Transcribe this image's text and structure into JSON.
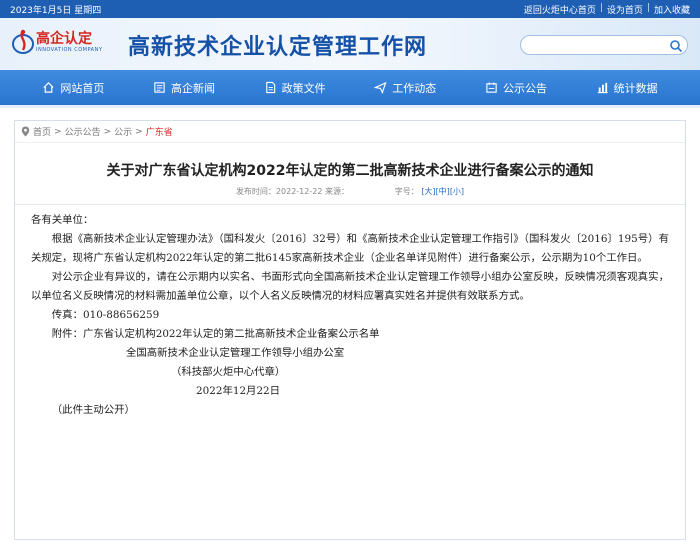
{
  "topbar": {
    "date": "2023年1月5日 星期四",
    "links": [
      "返回火炬中心首页",
      "设为首页",
      "加入收藏"
    ]
  },
  "header": {
    "logo_cn": "高企认定",
    "logo_en": "INNOVATION COMPANY",
    "site_title": "高新技术企业认定管理工作网",
    "search_placeholder": ""
  },
  "nav": {
    "items": [
      {
        "label": "网站首页",
        "icon": "home-icon"
      },
      {
        "label": "高企新闻",
        "icon": "news-icon"
      },
      {
        "label": "政策文件",
        "icon": "document-icon"
      },
      {
        "label": "工作动态",
        "icon": "paper-plane-icon"
      },
      {
        "label": "公示公告",
        "icon": "notice-icon"
      },
      {
        "label": "统计数据",
        "icon": "chart-icon"
      }
    ]
  },
  "breadcrumb": {
    "items": [
      "首页",
      "公示公告",
      "公示"
    ],
    "separator": ">",
    "current": "广东省"
  },
  "article": {
    "title": "关于对广东省认定机构2022年认定的第二批高新技术企业进行备案公示的通知",
    "publish_label": "发布时间：",
    "publish_time": "2022-12-22 来源：",
    "font_label": "字号：",
    "font_sizes": [
      "[大]",
      "[中]",
      "[小]"
    ],
    "salutation": "各有关单位：",
    "para1": "根据《高新技术企业认定管理办法》（国科发火〔2016〕32号）和《高新技术企业认定管理工作指引》（国科发火〔2016〕195号）有关规定，现将广东省认定机构2022年认定的第二批6145家高新技术企业（企业名单详见附件）进行备案公示，公示期为10个工作日。",
    "para2": "对公示企业有异议的，请在公示期内以实名、书面形式向全国高新技术企业认定管理工作领导小组办公室反映，反映情况须客观真实，以单位名义反映情况的材料需加盖单位公章，以个人名义反映情况的材料应署真实姓名并提供有效联系方式。",
    "fax": "传真：010-88656259",
    "attachment": "附件：广东省认定机构2022年认定的第二批高新技术企业备案公示名单",
    "signature_org": "全国高新技术企业认定管理工作领导小组办公室",
    "signature_sub": "（科技部火炬中心代章）",
    "signature_date": "2022年12月22日",
    "public_note": "（此件主动公开）"
  },
  "colors": {
    "brand_blue": "#1e5fb4",
    "nav_blue": "#3f8ce0",
    "accent_red": "#d6261f"
  }
}
